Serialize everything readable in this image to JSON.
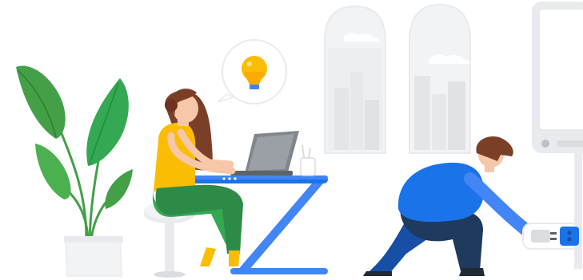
{
  "illustration": {
    "elements": [
      "potted-plant",
      "stool",
      "woman-at-laptop",
      "lightbulb-thought-bubble",
      "desk",
      "laptop",
      "pen-holder",
      "arched-windows",
      "kiosk-screen",
      "man-plugging-cable",
      "power-outlet"
    ]
  },
  "palette": {
    "plant_green": "#43a047",
    "shirt_yellow": "#fbbc04",
    "pants_green": "#34a853",
    "desk_blue": "#4285f4",
    "man_blue": "#1a73e8",
    "hair_brown": "#7b3f28",
    "wall_gray": "#e8eaed",
    "laptop_gray": "#80868b",
    "bulb_orange": "#f9ab00"
  }
}
